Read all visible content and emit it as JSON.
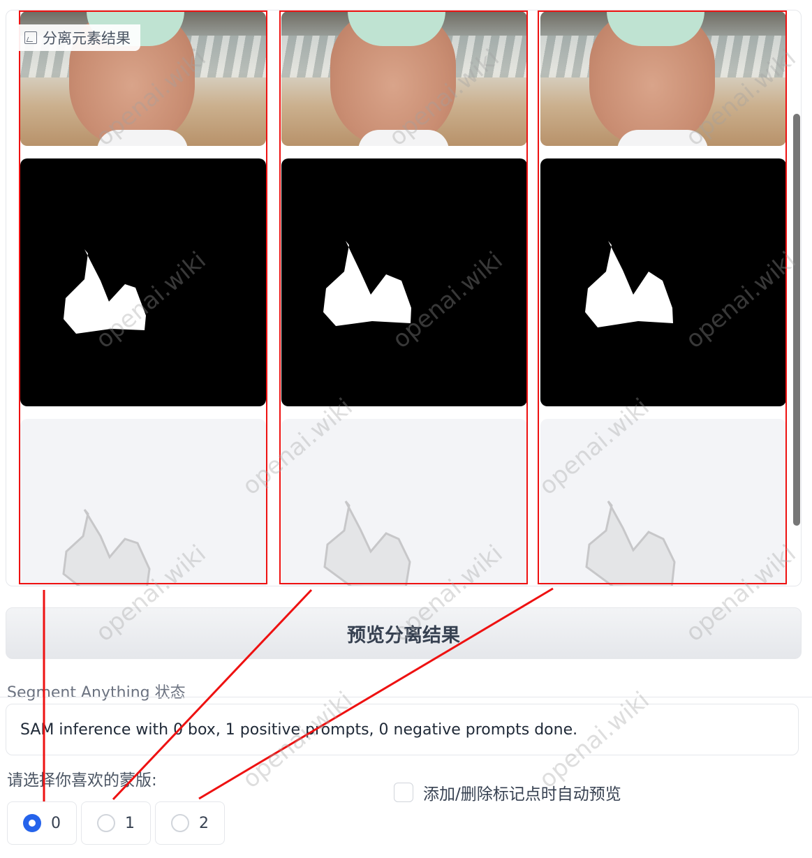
{
  "gallery": {
    "label": "分离元素结果",
    "columns": [
      {
        "name": "result-0"
      },
      {
        "name": "result-1"
      },
      {
        "name": "result-2"
      }
    ]
  },
  "preview_button": {
    "label": "预览分离结果"
  },
  "status": {
    "label": "Segment Anything 状态",
    "text": "SAM inference with 0 box, 1 positive prompts, 0 negative prompts done."
  },
  "mask_choice": {
    "label": "请选择你喜欢的蒙版:",
    "options": [
      "0",
      "1",
      "2"
    ],
    "selected": "0"
  },
  "auto_preview": {
    "label": "添加/删除标记点时自动预览",
    "checked": false
  },
  "watermark": "openai.wiki",
  "colors": {
    "annotation": "#ee1111",
    "accent": "#2563eb"
  }
}
